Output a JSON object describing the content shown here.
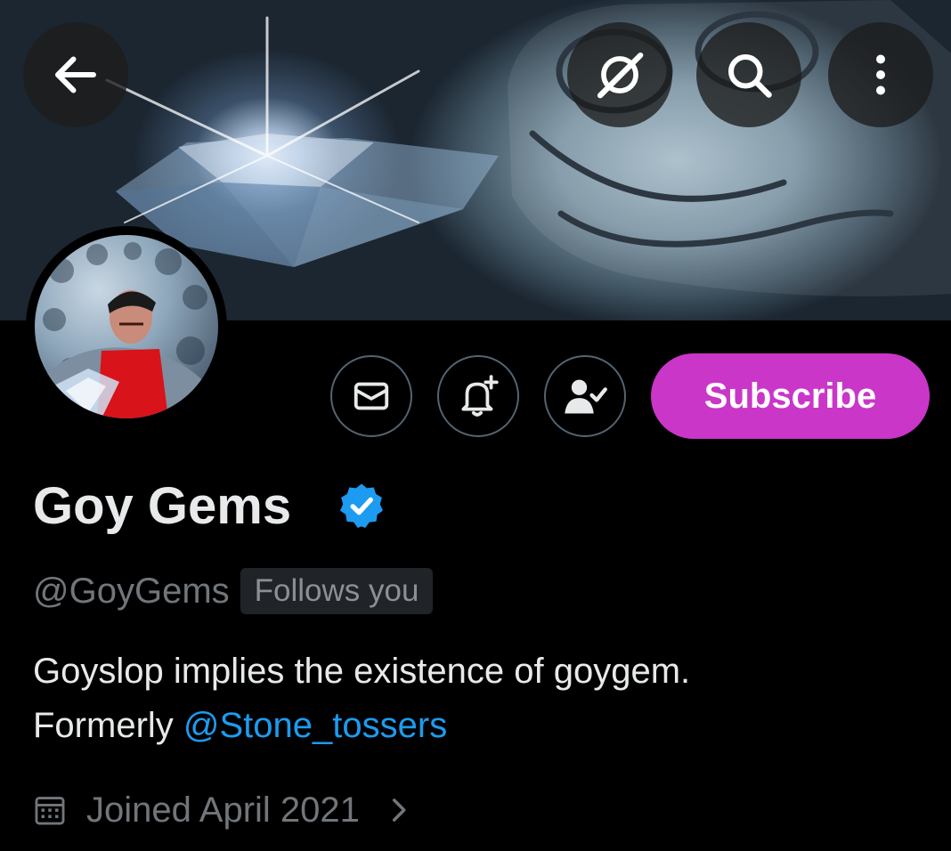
{
  "header": {
    "back_icon": "arrow-left-icon",
    "grok_icon": "grok-icon",
    "search_icon": "search-icon",
    "more_icon": "more-vertical-icon"
  },
  "profile": {
    "display_name": "Goy Gems",
    "verified": true,
    "handle": "@GoyGems",
    "follows_you_label": "Follows you",
    "bio_line1": "Goyslop implies the existence of goygem.",
    "bio_line2_prefix": "Formerly ",
    "bio_mention": "@Stone_tossers",
    "joined": "Joined April 2021"
  },
  "actions": {
    "message_icon": "envelope-icon",
    "notify_icon": "bell-plus-icon",
    "following_icon": "person-check-icon",
    "subscribe_label": "Subscribe"
  },
  "colors": {
    "background": "#000000",
    "subscribe": "#c936c8",
    "verified": "#1d9bf0",
    "mention": "#1d9bf0",
    "secondary_text": "#71767b"
  }
}
